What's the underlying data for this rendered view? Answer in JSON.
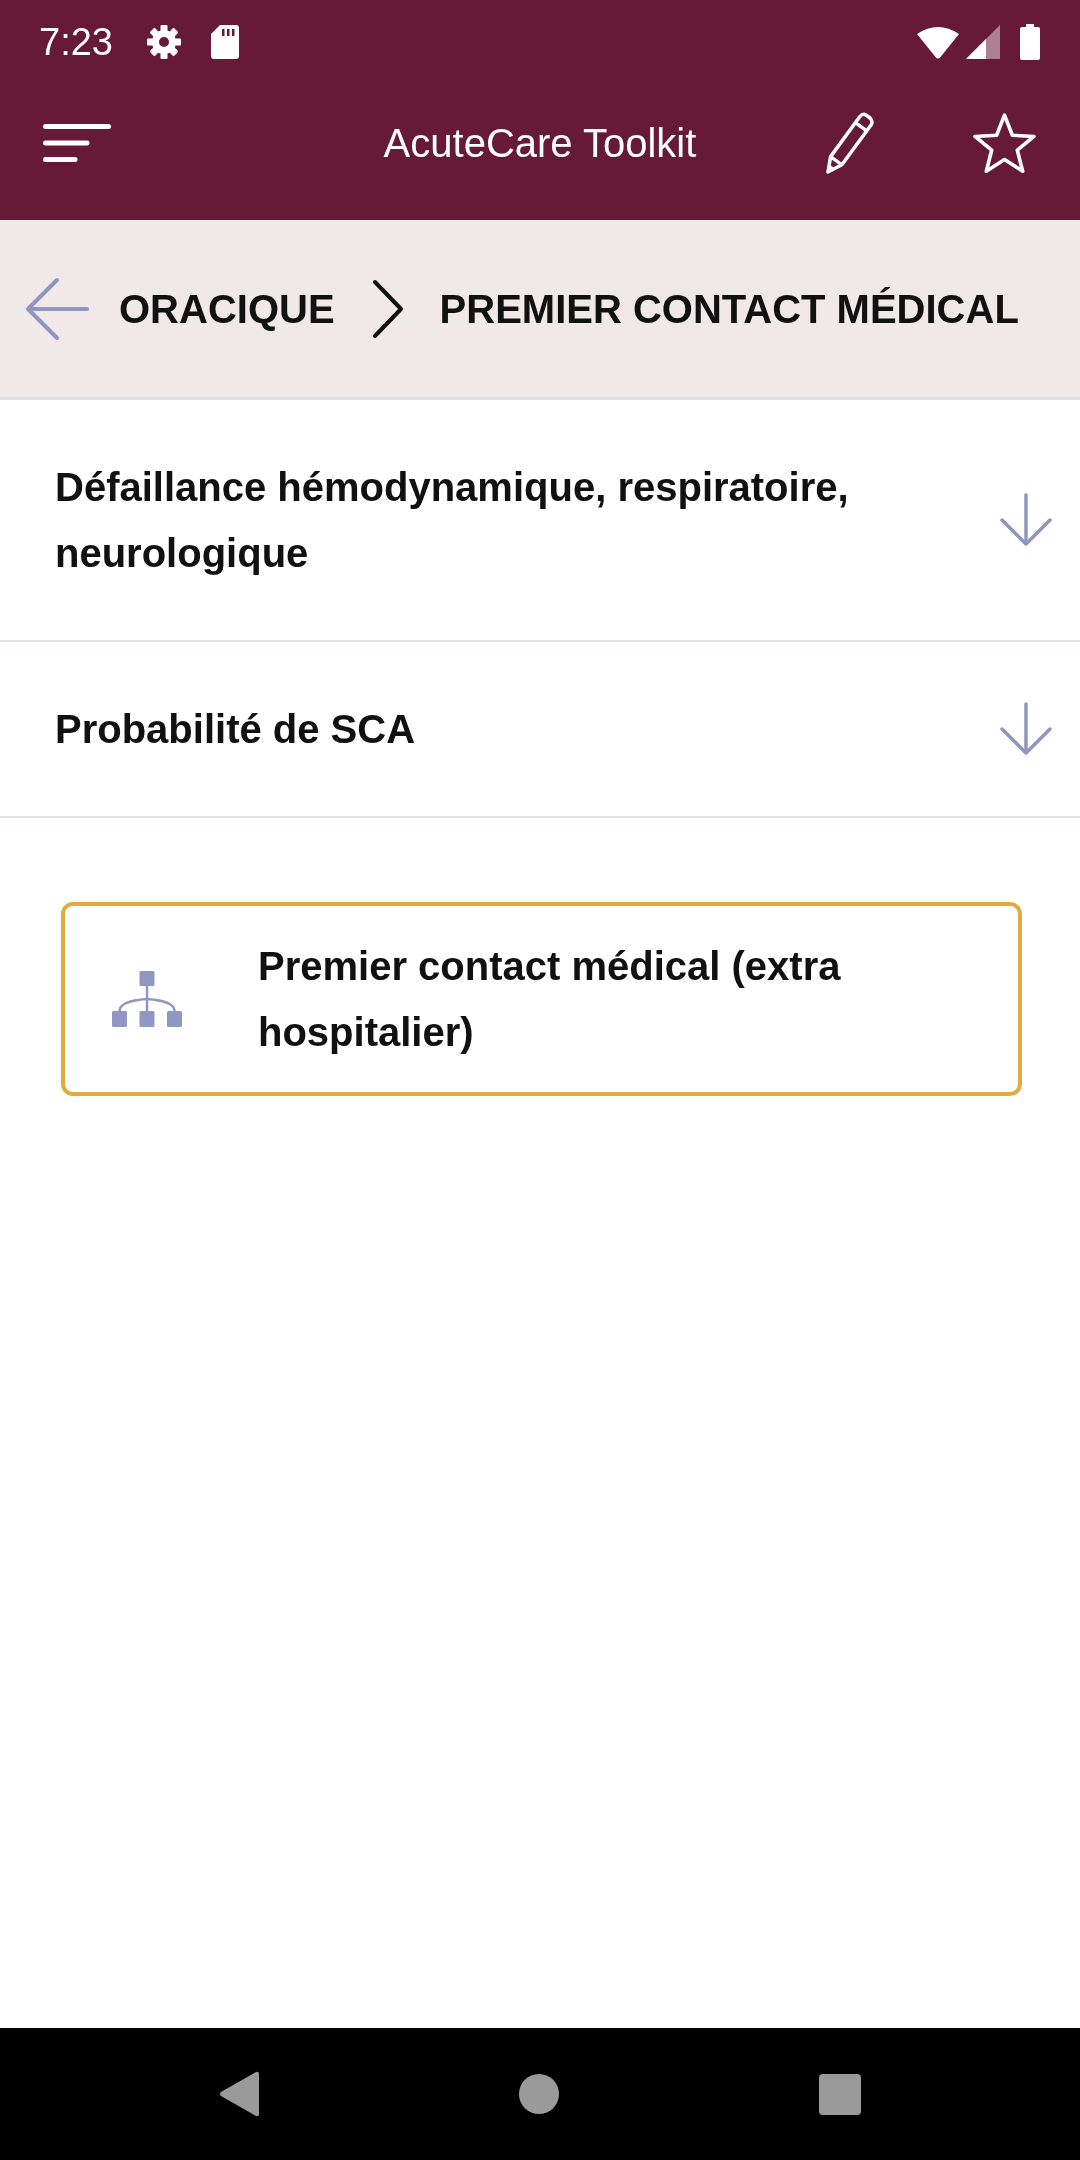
{
  "status_bar": {
    "time": "7:23"
  },
  "app_bar": {
    "title": "AcuteCare Toolkit"
  },
  "breadcrumb": {
    "items": [
      {
        "label": "ORACIQUE"
      },
      {
        "label": "PREMIER CONTACT MÉDICAL"
      }
    ]
  },
  "sections": [
    {
      "title": "Défaillance hémodynamique, respiratoire, neurologique",
      "expanded": false
    },
    {
      "title": "Probabilité de SCA",
      "expanded": false
    }
  ],
  "links": [
    {
      "label": "Premier contact médical (extra hospitalier)"
    }
  ]
}
